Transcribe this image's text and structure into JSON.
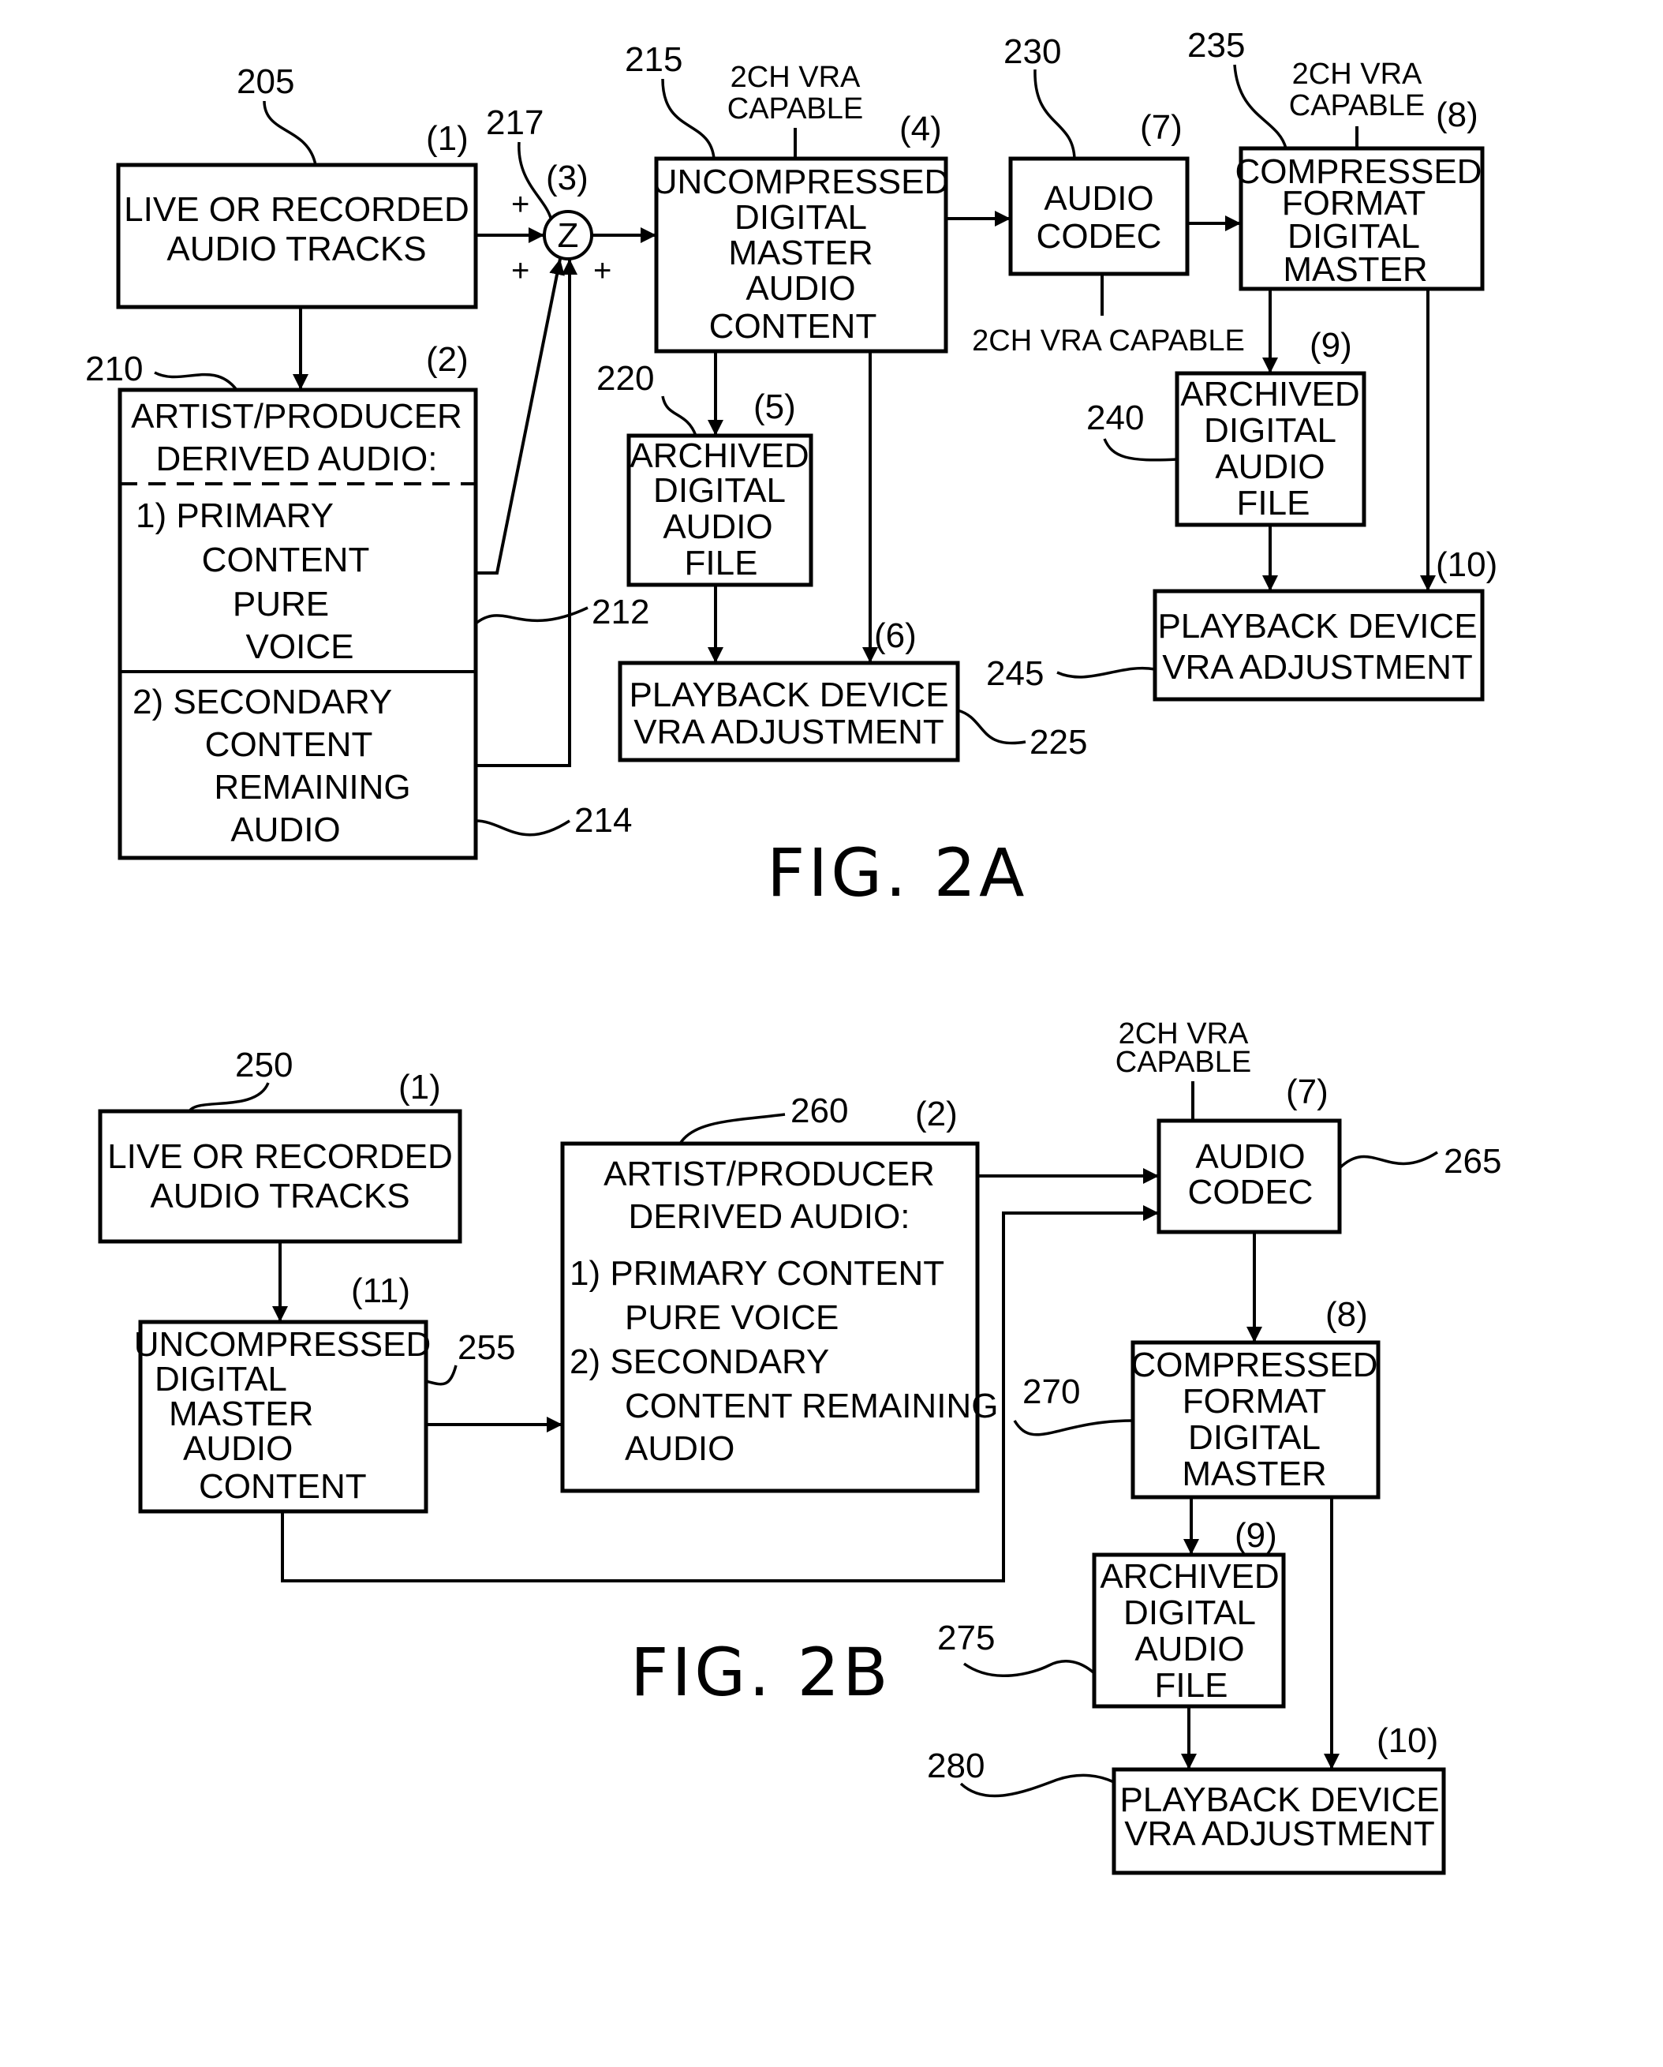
{
  "fig2a": {
    "caption": "FIG. 2A",
    "box1": {
      "ref": "205",
      "step": "(1)",
      "lines": [
        "LIVE  OR  RECORDED",
        "AUDIO  TRACKS"
      ]
    },
    "box2": {
      "ref": "210",
      "step": "(2)",
      "header": [
        "ARTIST/PRODUCER",
        "DERIVED  AUDIO:"
      ],
      "primary": {
        "ref": "212",
        "lines": [
          "1)  PRIMARY",
          "CONTENT",
          "PURE",
          "VOICE"
        ]
      },
      "secondary": {
        "ref": "214",
        "lines": [
          "2)  SECONDARY",
          "CONTENT",
          "REMAINING",
          "AUDIO"
        ]
      }
    },
    "summer": {
      "ref": "217",
      "step": "(3)",
      "symbol": "Z",
      "signs": [
        "+",
        "+",
        "+"
      ]
    },
    "box4": {
      "ref": "215",
      "step": "(4)",
      "note": [
        "2CH  VRA",
        "CAPABLE"
      ],
      "lines": [
        "UNCOMPRESSED",
        "DIGITAL",
        "MASTER",
        "AUDIO",
        "CONTENT"
      ]
    },
    "box5": {
      "ref": "220",
      "step": "(5)",
      "lines": [
        "ARCHIVED",
        "DIGITAL",
        "AUDIO",
        "FILE"
      ]
    },
    "box6": {
      "ref": "225",
      "step": "(6)",
      "lines": [
        "PLAYBACK  DEVICE",
        "VRA  ADJUSTMENT"
      ]
    },
    "box7": {
      "ref": "230",
      "step": "(7)",
      "note": "2CH  VRA  CAPABLE",
      "lines": [
        "AUDIO",
        "CODEC"
      ]
    },
    "box8": {
      "ref": "235",
      "step": "(8)",
      "note": [
        "2CH  VRA",
        "CAPABLE"
      ],
      "lines": [
        "COMPRESSED",
        "FORMAT",
        "DIGITAL",
        "MASTER"
      ]
    },
    "box9": {
      "ref": "240",
      "step": "(9)",
      "lines": [
        "ARCHIVED",
        "DIGITAL",
        "AUDIO",
        "FILE"
      ]
    },
    "box10": {
      "ref": "245",
      "step": "(10)",
      "lines": [
        "PLAYBACK  DEVICE",
        "VRA  ADJUSTMENT"
      ]
    }
  },
  "fig2b": {
    "caption": "FIG. 2B",
    "box1": {
      "ref": "250",
      "step": "(1)",
      "lines": [
        "LIVE  OR  RECORDED",
        "AUDIO  TRACKS"
      ]
    },
    "box11": {
      "ref": "255",
      "step": "(11)",
      "lines": [
        "UNCOMPRESSED",
        "DIGITAL",
        "MASTER",
        "AUDIO",
        "CONTENT"
      ]
    },
    "box2": {
      "ref": "260",
      "step": "(2)",
      "lines": [
        "ARTIST/PRODUCER",
        "DERIVED  AUDIO:",
        "1)  PRIMARY  CONTENT",
        "PURE  VOICE",
        "2)  SECONDARY",
        "CONTENT  REMAINING",
        "AUDIO"
      ]
    },
    "box7": {
      "ref": "265",
      "step": "(7)",
      "note": [
        "2CH  VRA",
        "CAPABLE"
      ],
      "lines": [
        "AUDIO",
        "CODEC"
      ]
    },
    "box8": {
      "ref": "270",
      "step": "(8)",
      "lines": [
        "COMPRESSED",
        "FORMAT",
        "DIGITAL",
        "MASTER"
      ]
    },
    "box9": {
      "ref": "275",
      "step": "(9)",
      "lines": [
        "ARCHIVED",
        "DIGITAL",
        "AUDIO",
        "FILE"
      ]
    },
    "box10": {
      "ref": "280",
      "step": "(10)",
      "lines": [
        "PLAYBACK  DEVICE",
        "VRA  ADJUSTMENT"
      ]
    }
  }
}
